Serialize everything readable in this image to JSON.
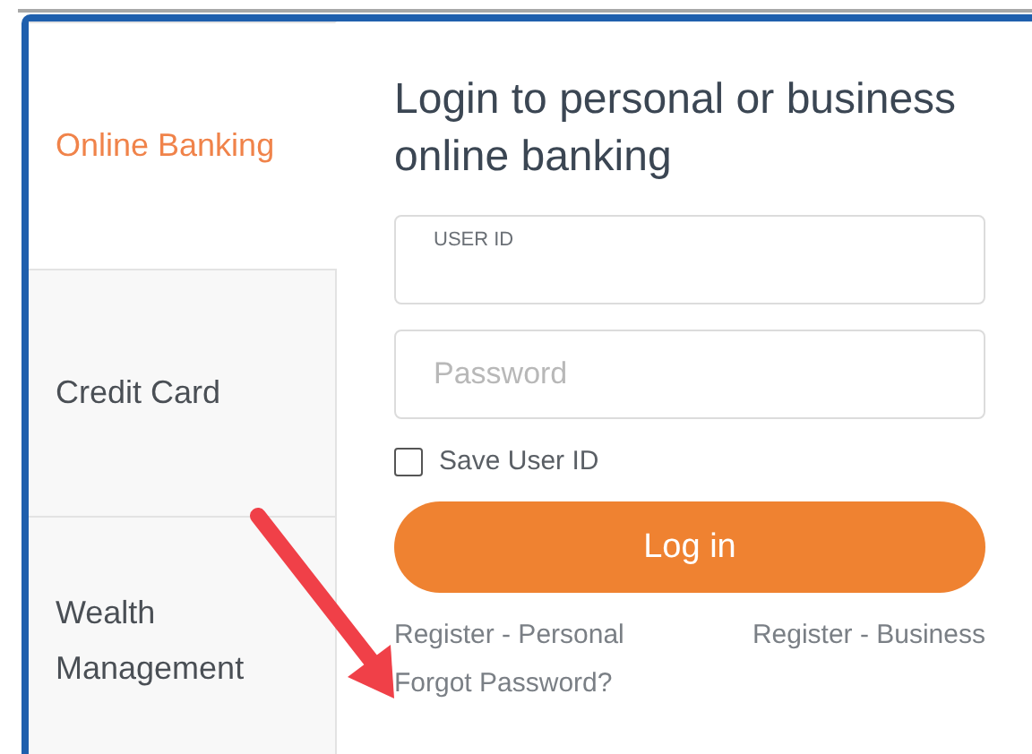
{
  "tabs": [
    {
      "label": "Online Banking",
      "selected": true
    },
    {
      "label": "Credit Card",
      "selected": false
    },
    {
      "label": "Wealth Management",
      "selected": false
    }
  ],
  "login": {
    "heading": "Login to personal or business online banking",
    "user_id": {
      "label": "USER ID"
    },
    "password": {
      "placeholder": "Password"
    },
    "save_user_id": {
      "label": "Save User ID",
      "checked": false
    },
    "button": "Log in",
    "links": [
      "Register - Personal",
      "Register - Business"
    ],
    "forgot": "Forgot Password?"
  }
}
